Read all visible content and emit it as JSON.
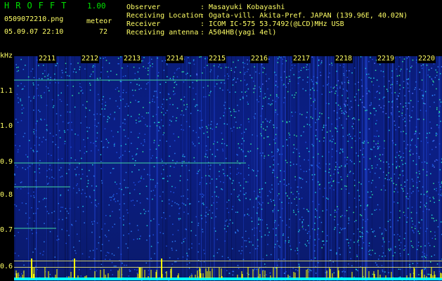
{
  "app": {
    "name": "HROFFT",
    "version": "1.00"
  },
  "file": {
    "name": "0509072210.png",
    "datetime": "05.09.07 22:10"
  },
  "meteor": {
    "label": "meteor",
    "count": "72"
  },
  "info": [
    {
      "key": "Observer",
      "value": ": Masayuki Kobayashi"
    },
    {
      "key": "Receiving Location",
      "value": ": Ogata-vill. Akita-Pref. JAPAN (139.96E, 40.02N)"
    },
    {
      "key": "Receiver",
      "value": ": ICOM IC-575 53.7492(@LCD)MHz USB"
    },
    {
      "key": "Receiving antenna",
      "value": ": A504HB(yagi 4el)"
    }
  ],
  "spectrogram": {
    "yunit": "kHz",
    "yticks": [
      "1.1",
      "1.0",
      "0.9",
      "0.8",
      "0.7",
      "0.6"
    ],
    "time_labels": [
      "2211",
      "2212",
      "2213",
      "2214",
      "2215",
      "2216",
      "2217",
      "2218",
      "2219",
      "2220"
    ]
  },
  "colors": {
    "text": "#ffff66",
    "title": "#00e000",
    "spectrum_low": "#0a1d7a",
    "spectrum_high": "#00e8a0",
    "baseline": "#00ffff",
    "peaks": "#ffff00"
  }
}
